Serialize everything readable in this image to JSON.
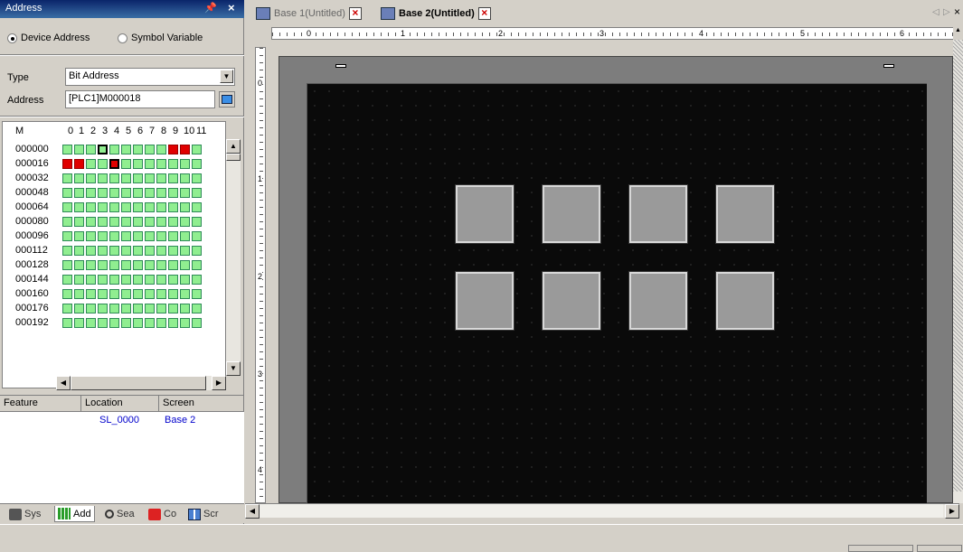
{
  "panel": {
    "title": "Address",
    "pin": "⬍",
    "close": "✕",
    "radio_device": "Device Address",
    "radio_symbol": "Symbol Variable",
    "type_label": "Type",
    "type_value": "Bit Address",
    "address_label": "Address",
    "address_value": "[PLC1]M000018"
  },
  "grid": {
    "corner": "M",
    "columns": [
      "0",
      "1",
      "2",
      "3",
      "4",
      "5",
      "6",
      "7",
      "8",
      "9",
      "10",
      "11"
    ],
    "rows": [
      "000000",
      "000016",
      "000032",
      "000048",
      "000064",
      "000080",
      "000096",
      "000112",
      "000128",
      "000144",
      "000160",
      "000176",
      "000192"
    ]
  },
  "features": {
    "headers": [
      "Feature",
      "Location",
      "Screen"
    ],
    "rows": [
      {
        "feature": "",
        "location": "SL_0000",
        "screen": "Base 2"
      }
    ]
  },
  "bottom_tabs": [
    "Sys",
    "Add",
    "Sea",
    "Co",
    "Scr"
  ],
  "doc_tabs": [
    "Base 1(Untitled)",
    "Base 2(Untitled)"
  ],
  "rulers": {
    "h": [
      "0",
      "1",
      "2",
      "3",
      "4",
      "5",
      "6"
    ],
    "v": [
      "0",
      "1",
      "2",
      "3",
      "4"
    ]
  },
  "colors": {
    "bit_on": "#e00000",
    "bit_off": "#90ee90",
    "screen_bg": "#0a0a0a"
  }
}
